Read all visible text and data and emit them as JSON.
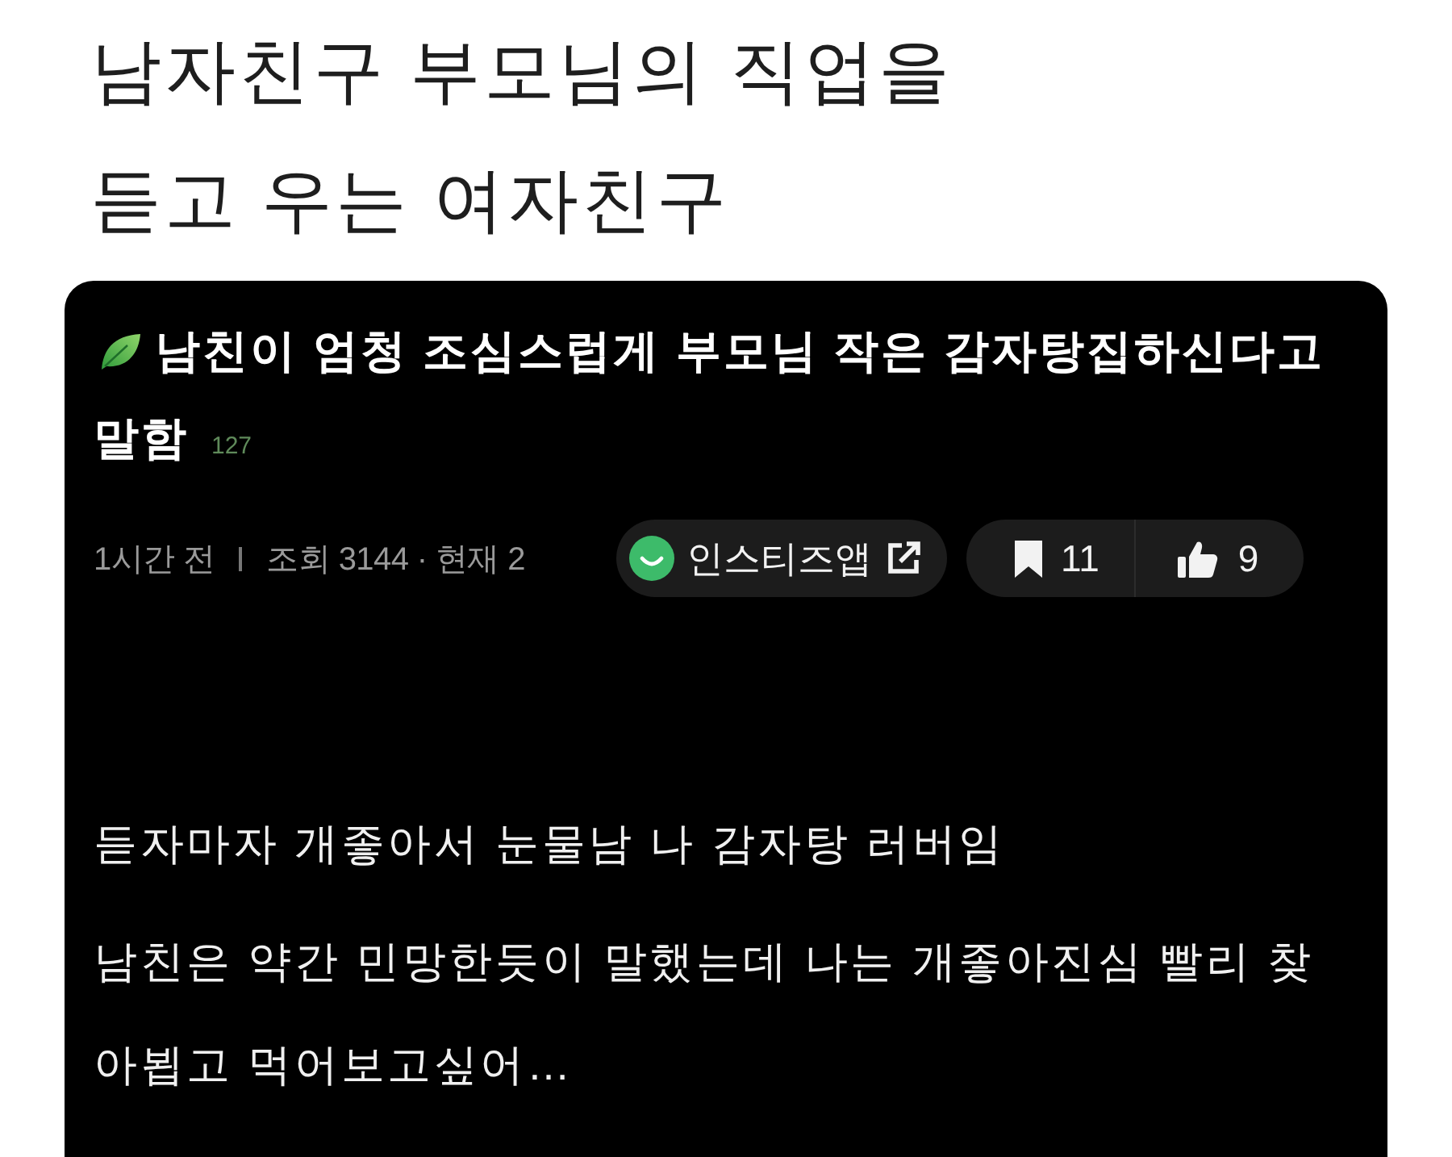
{
  "headline": "남자친구 부모님의 직업을\n듣고 우는 여자친구",
  "post": {
    "title_lines": [
      "남친이 엄청 조심스럽게 부모님 작은 감자탕집하신다고",
      "말함"
    ],
    "comment_count": "127",
    "time": "1시간 전",
    "stats": "조회 3144 · 현재 2",
    "app_link": "인스티즈앱",
    "scrap_count": "11",
    "like_count": "9",
    "body": [
      "듣자마자 개좋아서 눈물남 나 감자탕 러버임",
      "남친은 약간 민망한듯이 말했는데 나는 개좋아진심 빨리 찾\n아뵙고 먹어보고싶어…"
    ]
  }
}
